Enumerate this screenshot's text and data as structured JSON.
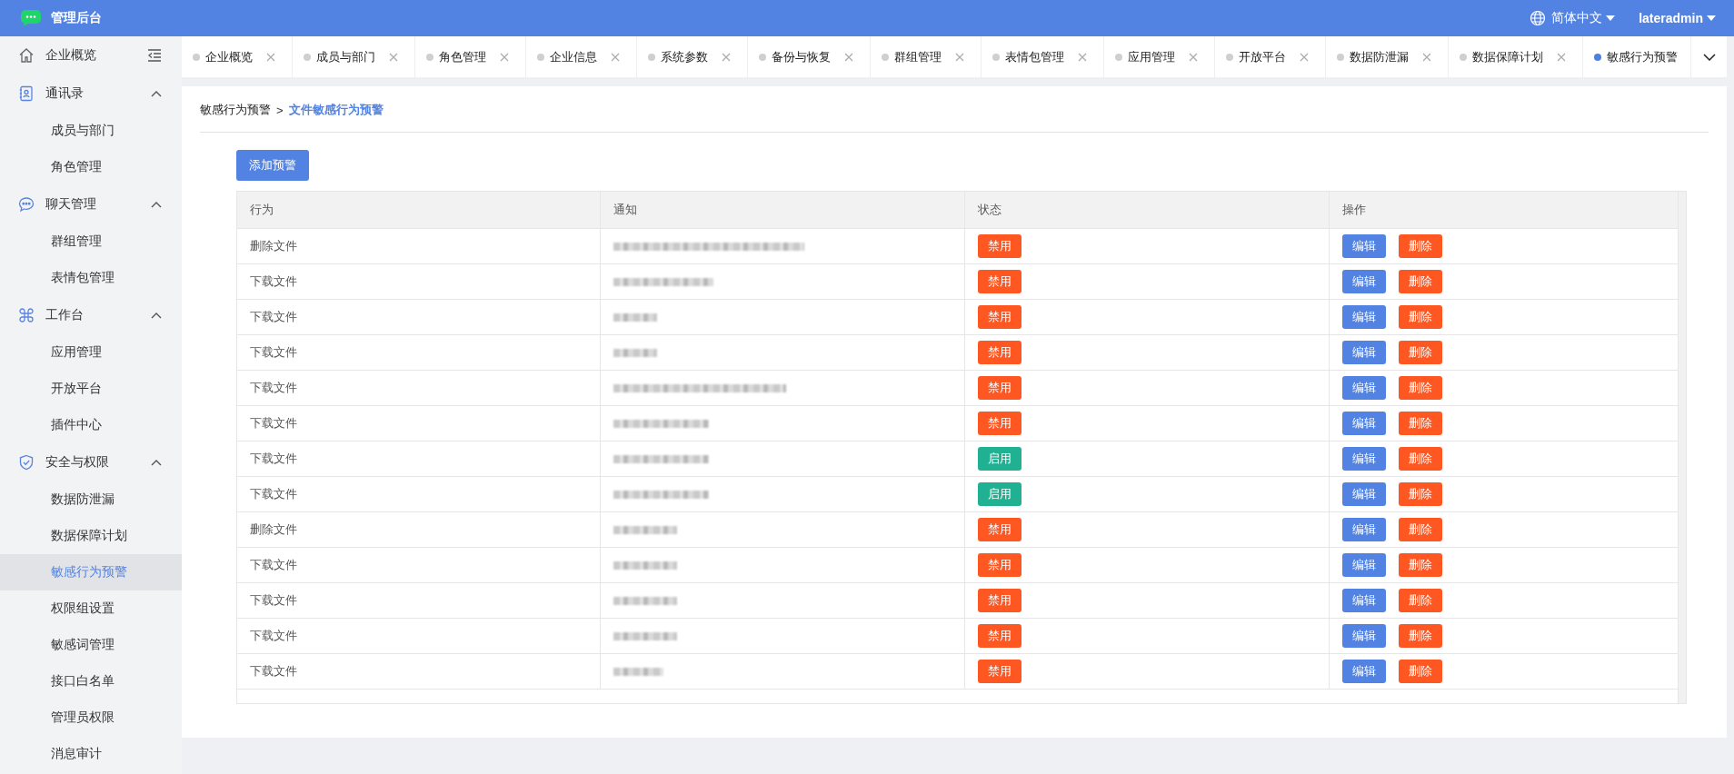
{
  "header": {
    "title": "管理后台",
    "language": "简体中文",
    "user": "lateradmin"
  },
  "sidebar": {
    "items": [
      {
        "label": "企业概览",
        "selected": false
      },
      {
        "label": "通讯录",
        "expanded": true,
        "children": [
          {
            "label": "成员与部门",
            "selected": false
          },
          {
            "label": "角色管理",
            "selected": false
          }
        ]
      },
      {
        "label": "聊天管理",
        "expanded": true,
        "children": [
          {
            "label": "群组管理",
            "selected": false
          },
          {
            "label": "表情包管理",
            "selected": false
          }
        ]
      },
      {
        "label": "工作台",
        "expanded": true,
        "children": [
          {
            "label": "应用管理",
            "selected": false
          },
          {
            "label": "开放平台",
            "selected": false
          },
          {
            "label": "插件中心",
            "selected": false
          }
        ]
      },
      {
        "label": "安全与权限",
        "expanded": true,
        "children": [
          {
            "label": "数据防泄漏",
            "selected": false
          },
          {
            "label": "数据保障计划",
            "selected": false
          },
          {
            "label": "敏感行为预警",
            "selected": true
          },
          {
            "label": "权限组设置",
            "selected": false
          },
          {
            "label": "敏感词管理",
            "selected": false
          },
          {
            "label": "接口白名单",
            "selected": false
          },
          {
            "label": "管理员权限",
            "selected": false
          },
          {
            "label": "消息审计",
            "selected": false
          }
        ]
      }
    ]
  },
  "tabs": [
    {
      "label": "企业概览",
      "selected": false
    },
    {
      "label": "成员与部门",
      "selected": false
    },
    {
      "label": "角色管理",
      "selected": false
    },
    {
      "label": "企业信息",
      "selected": false
    },
    {
      "label": "系统参数",
      "selected": false
    },
    {
      "label": "备份与恢复",
      "selected": false
    },
    {
      "label": "群组管理",
      "selected": false
    },
    {
      "label": "表情包管理",
      "selected": false
    },
    {
      "label": "应用管理",
      "selected": false
    },
    {
      "label": "开放平台",
      "selected": false
    },
    {
      "label": "数据防泄漏",
      "selected": false
    },
    {
      "label": "数据保障计划",
      "selected": false
    },
    {
      "label": "敏感行为预警",
      "selected": true
    }
  ],
  "breadcrumb": {
    "parent": "敏感行为预警",
    "separator": ">",
    "current": "文件敏感行为预警"
  },
  "add_button": "添加预警",
  "table": {
    "columns": [
      "行为",
      "通知",
      "状态",
      "操作"
    ],
    "rows": [
      {
        "action": "删除文件",
        "status": {
          "label": "禁用",
          "kind": "disable"
        },
        "edit": "编辑",
        "delete": "删除"
      },
      {
        "action": "下载文件",
        "status": {
          "label": "禁用",
          "kind": "disable"
        },
        "edit": "编辑",
        "delete": "删除"
      },
      {
        "action": "下载文件",
        "status": {
          "label": "禁用",
          "kind": "disable"
        },
        "edit": "编辑",
        "delete": "删除"
      },
      {
        "action": "下载文件",
        "status": {
          "label": "禁用",
          "kind": "disable"
        },
        "edit": "编辑",
        "delete": "删除"
      },
      {
        "action": "下载文件",
        "status": {
          "label": "禁用",
          "kind": "disable"
        },
        "edit": "编辑",
        "delete": "删除"
      },
      {
        "action": "下载文件",
        "status": {
          "label": "禁用",
          "kind": "disable"
        },
        "edit": "编辑",
        "delete": "删除"
      },
      {
        "action": "下载文件",
        "status": {
          "label": "启用",
          "kind": "enable"
        },
        "edit": "编辑",
        "delete": "删除"
      },
      {
        "action": "下载文件",
        "status": {
          "label": "启用",
          "kind": "enable"
        },
        "edit": "编辑",
        "delete": "删除"
      },
      {
        "action": "删除文件",
        "status": {
          "label": "禁用",
          "kind": "disable"
        },
        "edit": "编辑",
        "delete": "删除"
      },
      {
        "action": "下载文件",
        "status": {
          "label": "禁用",
          "kind": "disable"
        },
        "edit": "编辑",
        "delete": "删除"
      },
      {
        "action": "下载文件",
        "status": {
          "label": "禁用",
          "kind": "disable"
        },
        "edit": "编辑",
        "delete": "删除"
      },
      {
        "action": "下载文件",
        "status": {
          "label": "禁用",
          "kind": "disable"
        },
        "edit": "编辑",
        "delete": "删除"
      },
      {
        "action": "下载文件",
        "status": {
          "label": "禁用",
          "kind": "disable"
        },
        "edit": "编辑",
        "delete": "删除"
      }
    ]
  }
}
